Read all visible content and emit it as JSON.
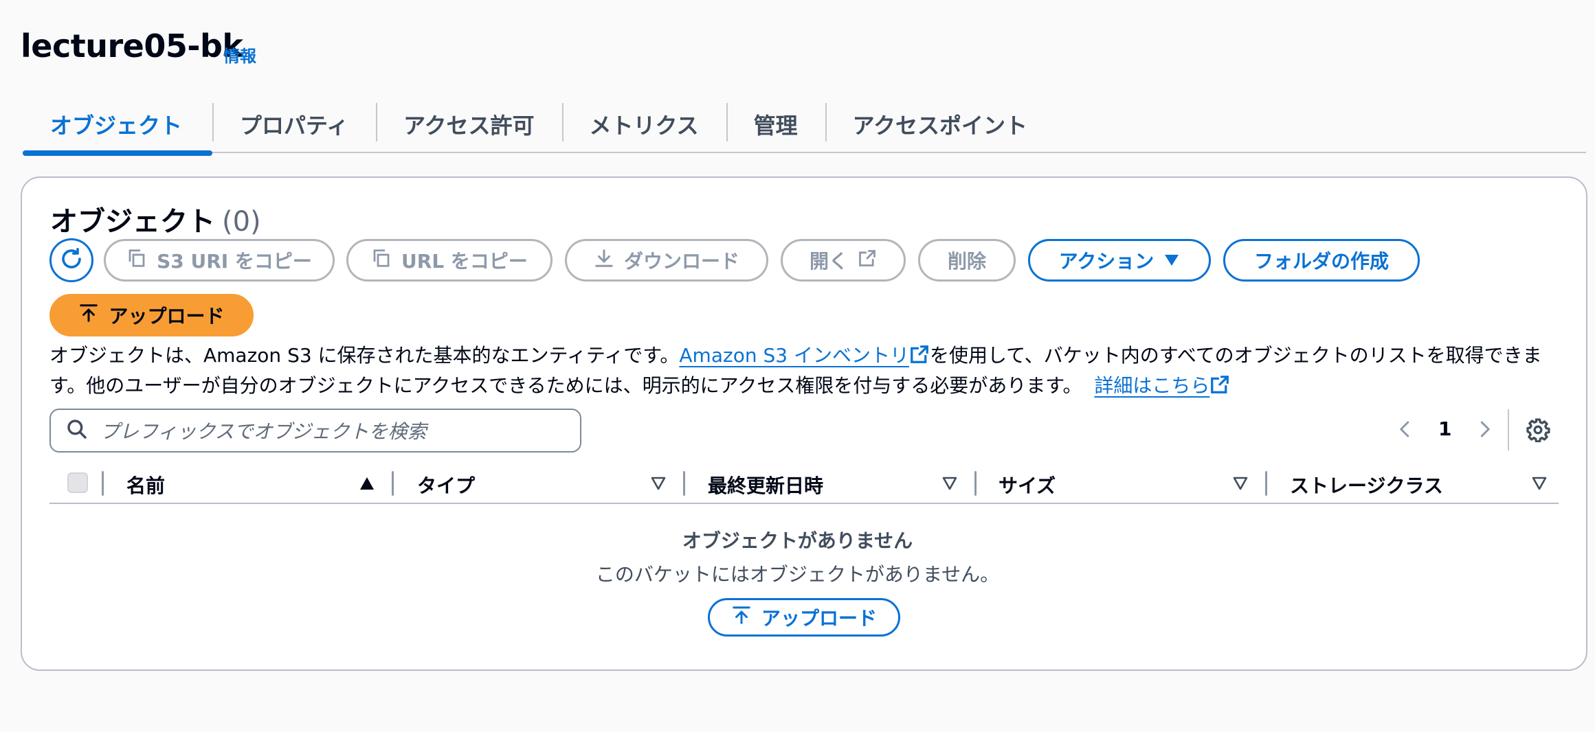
{
  "header": {
    "bucket_name": "lecture05-bk",
    "info_link": "情報"
  },
  "tabs": [
    {
      "label": "オブジェクト",
      "active": true
    },
    {
      "label": "プロパティ"
    },
    {
      "label": "アクセス許可"
    },
    {
      "label": "メトリクス"
    },
    {
      "label": "管理"
    },
    {
      "label": "アクセスポイント"
    }
  ],
  "panel": {
    "title": "オブジェクト",
    "count": "(0)",
    "toolbar": {
      "copy_s3_uri": "S3 URI をコピー",
      "copy_url": "URL をコピー",
      "download": "ダウンロード",
      "open": "開く",
      "delete": "削除",
      "actions": "アクション",
      "create_folder": "フォルダの作成",
      "upload": "アップロード"
    },
    "description": {
      "part1": "オブジェクトは、Amazon S3 に保存された基本的なエンティティです。",
      "inventory_link": "Amazon S3 インベントリ",
      "part2": "を使用して、バケット内のすべてのオブジェクトのリストを取得できます。他のユーザーが自分のオブジェクトにアクセスできるためには、明示的にアクセス権限を付与する必要があります。",
      "learn_more_link": "詳細はこちら"
    },
    "search": {
      "placeholder": "プレフィックスでオブジェクトを検索"
    },
    "pagination": {
      "current_page": "1"
    },
    "table": {
      "columns": [
        "名前",
        "タイプ",
        "最終更新日時",
        "サイズ",
        "ストレージクラス"
      ],
      "sorted_column": "名前",
      "sort_direction": "ascending"
    },
    "empty_state": {
      "title": "オブジェクトがありません",
      "message": "このバケットにはオブジェクトがありません。",
      "upload_button": "アップロード"
    }
  },
  "colors": {
    "accent": "#0972d3",
    "primary_button": "#f89d34",
    "disabled": "#8d99a8",
    "text": "#000716"
  }
}
